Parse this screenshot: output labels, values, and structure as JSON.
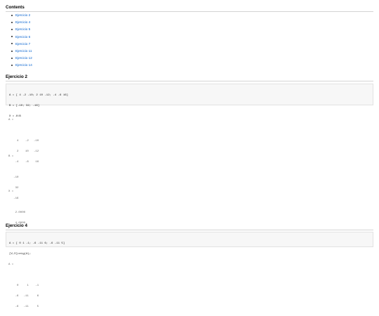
{
  "contents": {
    "title": "Contents",
    "links": [
      "Ejercicio 2",
      "Ejercicio 4",
      "Ejercicio 5",
      "Ejercicio 6",
      "Ejercicio 7",
      "Ejercicio 11",
      "Ejercicio 12",
      "Ejercicio 14"
    ]
  },
  "ej2": {
    "title": "Ejercicio 2",
    "code": [
      "A = [ 4 -2 -10; 2 10 -12; -4 -6 16]",
      "B = [-10; 32; -16]",
      "X = A\\B"
    ],
    "outA": [
      "A =",
      "",
      "     4    -2   -10",
      "     2    10   -12",
      "    -4    -6    16"
    ],
    "outB": [
      "B =",
      "",
      "   -10",
      "    32",
      "   -16"
    ],
    "outX": [
      "X =",
      "",
      "    2.0000",
      "    4.0000",
      "    1.0000"
    ]
  },
  "ej4": {
    "title": "Ejercicio 4",
    "code": [
      "A = [ 0 1 -1; -6 -11 6; -6 -11 5]",
      "[V,D]=eig(A);"
    ],
    "outA": [
      "A =",
      "",
      "     0     1    -1",
      "    -6   -11     6",
      "    -6   -11     5"
    ]
  }
}
